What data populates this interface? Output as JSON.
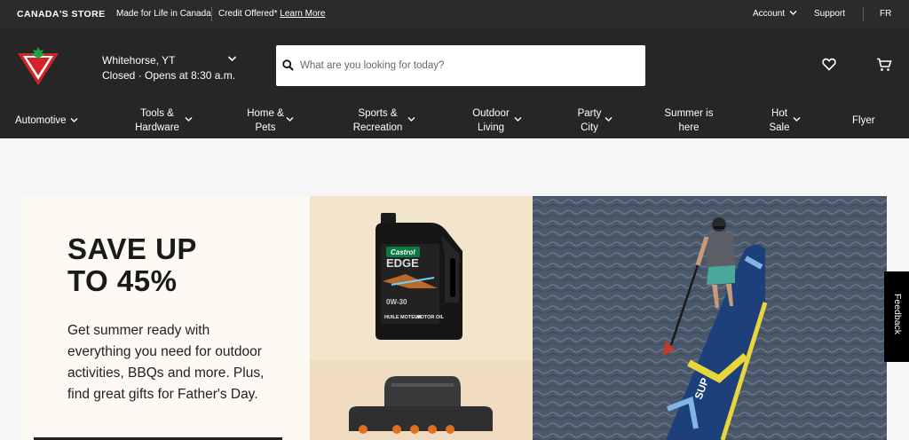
{
  "topbar": {
    "brand": "CANADA'S STORE",
    "tagline": "Made for Life in Canada",
    "credit": "Credit Offered*",
    "learn_more": "Learn More",
    "account": "Account",
    "support": "Support",
    "language": "FR"
  },
  "header": {
    "store_city": "Whitehorse, YT",
    "store_status": "Closed",
    "store_hours": "· Opens at 8:30 a.m.",
    "search_placeholder": "What are you looking for today?"
  },
  "nav": {
    "items": [
      {
        "l1": "Automotive",
        "l2": ""
      },
      {
        "l1": "Tools &",
        "l2": "Hardware"
      },
      {
        "l1": "Home &",
        "l2": "Pets"
      },
      {
        "l1": "Sports &",
        "l2": "Recreation"
      },
      {
        "l1": "Outdoor",
        "l2": "Living"
      },
      {
        "l1": "Party",
        "l2": "City"
      },
      {
        "l1": "Summer is",
        "l2": "here"
      },
      {
        "l1": "Hot",
        "l2": "Sale"
      },
      {
        "l1": "Flyer",
        "l2": ""
      }
    ]
  },
  "hero": {
    "headline_1": "SAVE UP",
    "headline_2": "TO 45%",
    "body": "Get summer ready with everything you need for outdoor activities, BBQs and more. Plus, find great gifts for Father's Day.",
    "product_brand": "Castrol",
    "product_name": "EDGE",
    "product_grade": "0W-30",
    "product_sub1": "HUILE MOTEUR",
    "product_sub2": "MOTOR OIL",
    "board_text": "SUP"
  },
  "feedback": "Feedback",
  "colors": {
    "brand_red": "#d2232a",
    "topbar_bg": "#2b2b2b",
    "header_bg": "#262626"
  }
}
